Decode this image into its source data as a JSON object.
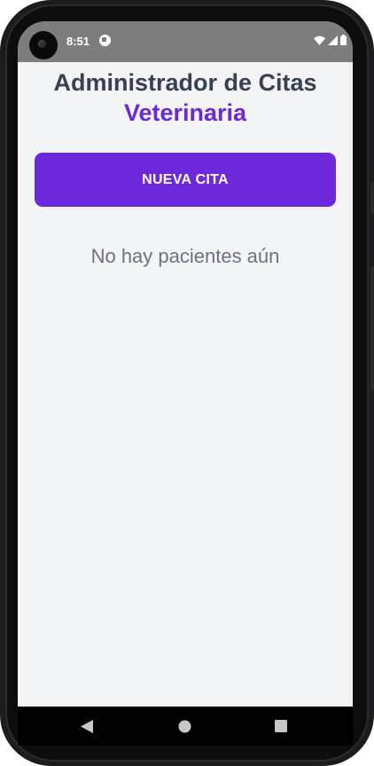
{
  "status_bar": {
    "time": "8:51",
    "icons": [
      "camera-cutout",
      "app-notification-icon",
      "wifi-icon",
      "signal-icon",
      "battery-icon"
    ]
  },
  "header": {
    "title": "Administrador de Citas",
    "subtitle": "Veterinaria"
  },
  "actions": {
    "new_appointment_label": "NUEVA CITA"
  },
  "patients": {
    "empty_message": "No hay pacientes aún"
  },
  "navigation": {
    "buttons": [
      "back",
      "home",
      "recents"
    ]
  },
  "colors": {
    "accent": "#6d28d9",
    "title_text": "#374151",
    "muted_text": "#6b7280",
    "background": "#f3f4f6",
    "status_bar": "#7d7d7d"
  }
}
